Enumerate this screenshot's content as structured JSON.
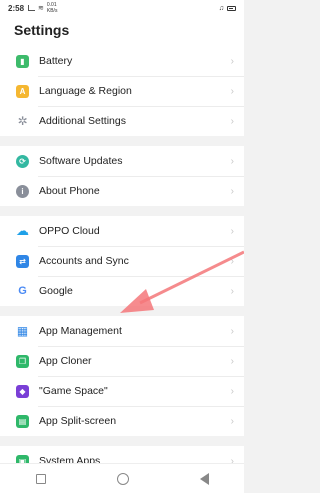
{
  "status_bar": {
    "time": "2:58",
    "net_speed_value": "0.01",
    "net_speed_unit": "KB/s"
  },
  "header": {
    "title": "Settings"
  },
  "groups": [
    {
      "items": [
        {
          "label": "Battery",
          "icon": "battery-icon",
          "color": "#3dbb6b"
        },
        {
          "label": "Language & Region",
          "icon": "language-icon",
          "color": "#f5b731"
        },
        {
          "label": "Additional Settings",
          "icon": "gear-icon",
          "color": "#8a8f9a"
        }
      ]
    },
    {
      "items": [
        {
          "label": "Software Updates",
          "icon": "update-icon",
          "color": "#33b8a1"
        },
        {
          "label": "About Phone",
          "icon": "info-icon",
          "color": "#8a8f9a"
        }
      ]
    },
    {
      "items": [
        {
          "label": "OPPO Cloud",
          "icon": "cloud-icon",
          "color": "#1ea0e8"
        },
        {
          "label": "Accounts and Sync",
          "icon": "account-icon",
          "color": "#2f86e6"
        },
        {
          "label": "Google",
          "icon": "google-icon",
          "color": "#4a8af4"
        }
      ]
    },
    {
      "items": [
        {
          "label": "App Management",
          "icon": "apps-grid-icon",
          "color": "#2f86e6"
        },
        {
          "label": "App Cloner",
          "icon": "app-cloner-icon",
          "color": "#2fb86a"
        },
        {
          "label": "\"Game Space\"",
          "icon": "game-space-icon",
          "color": "#7a3fd6"
        },
        {
          "label": "App Split-screen",
          "icon": "split-screen-icon",
          "color": "#2fb86a"
        }
      ]
    },
    {
      "items": [
        {
          "label": "System Apps",
          "icon": "system-apps-icon",
          "color": "#2fb86a"
        }
      ]
    }
  ],
  "annotation": {
    "color": "#f4777a"
  }
}
